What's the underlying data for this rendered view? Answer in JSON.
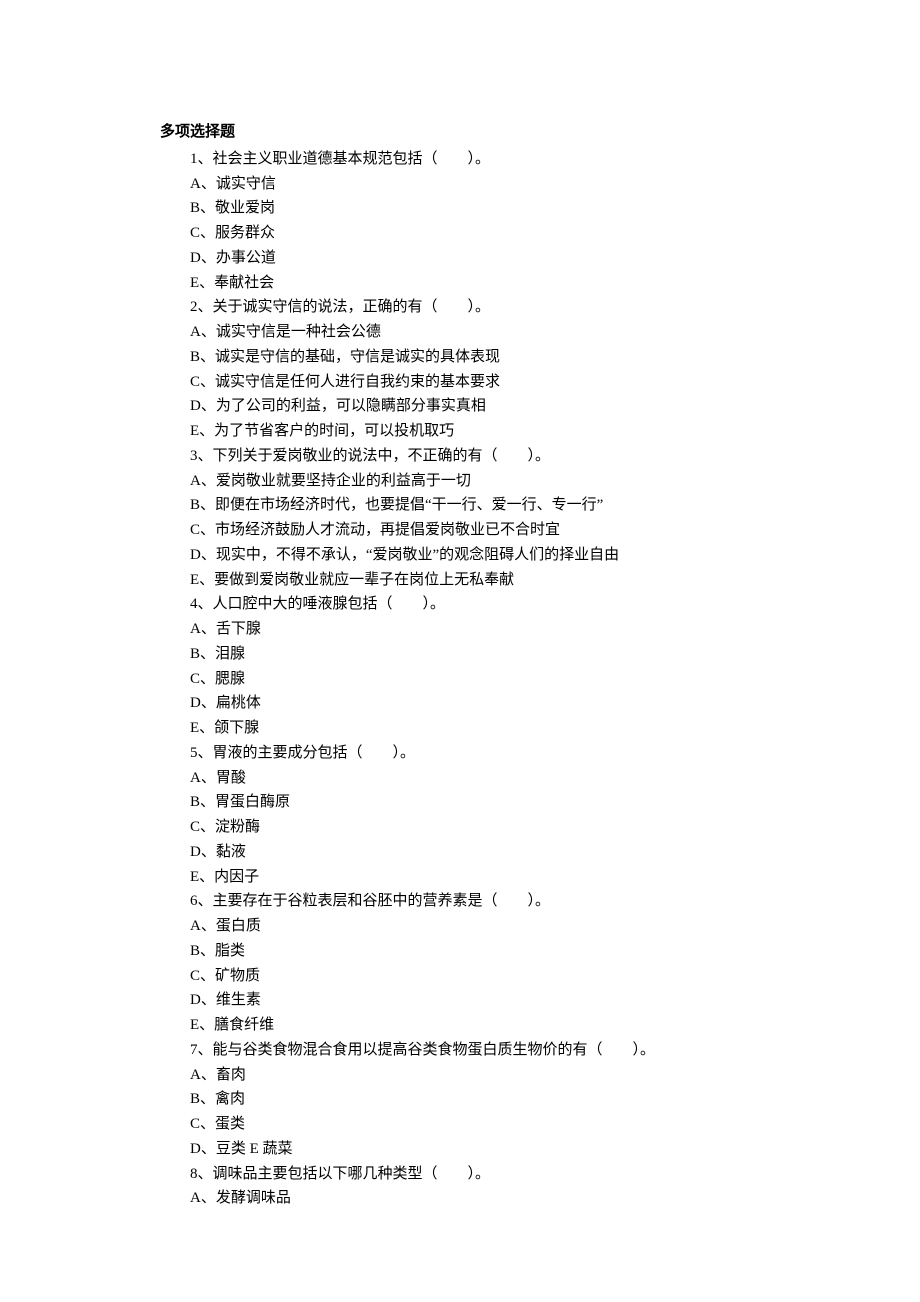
{
  "section_title": "多项选择题",
  "questions": [
    {
      "stem": "1、社会主义职业道德基本规范包括（　　）。",
      "options": [
        "A、诚实守信",
        "B、敬业爱岗",
        "C、服务群众",
        "D、办事公道",
        "E、奉献社会"
      ]
    },
    {
      "stem": "2、关于诚实守信的说法，正确的有（　　）。",
      "options": [
        "A、诚实守信是一种社会公德",
        "B、诚实是守信的基础，守信是诚实的具体表现",
        "C、诚实守信是任何人进行自我约束的基本要求",
        "D、为了公司的利益，可以隐瞒部分事实真相",
        "E、为了节省客户的时间，可以投机取巧"
      ]
    },
    {
      "stem": "3、下列关于爱岗敬业的说法中，不正确的有（　　）。",
      "options": [
        "A、爱岗敬业就要坚持企业的利益高于一切",
        "B、即便在市场经济时代，也要提倡“干一行、爱一行、专一行”",
        "C、市场经济鼓励人才流动，再提倡爱岗敬业已不合时宜",
        "D、现实中，不得不承认，“爱岗敬业”的观念阻碍人们的择业自由",
        "E、要做到爱岗敬业就应一辈子在岗位上无私奉献"
      ]
    },
    {
      "stem": "4、人口腔中大的唾液腺包括（　　）。",
      "options": [
        "A、舌下腺",
        "B、泪腺",
        "C、腮腺",
        "D、扁桃体",
        "E、颌下腺"
      ]
    },
    {
      "stem": "5、胃液的主要成分包括（　　）。",
      "options": [
        "A、胃酸",
        "B、胃蛋白酶原",
        "C、淀粉酶",
        "D、黏液",
        "E、内因子"
      ]
    },
    {
      "stem": "6、主要存在于谷粒表层和谷胚中的营养素是（　　）。",
      "options": [
        "A、蛋白质",
        "B、脂类",
        "C、矿物质",
        "D、维生素",
        "E、膳食纤维"
      ]
    },
    {
      "stem": "7、能与谷类食物混合食用以提高谷类食物蛋白质生物价的有（　　）。",
      "options": [
        "A、畜肉",
        "B、禽肉",
        "C、蛋类",
        "D、豆类 E 蔬菜"
      ]
    },
    {
      "stem": "8、调味品主要包括以下哪几种类型（　　）。",
      "options": [
        "A、发酵调味品"
      ]
    }
  ]
}
